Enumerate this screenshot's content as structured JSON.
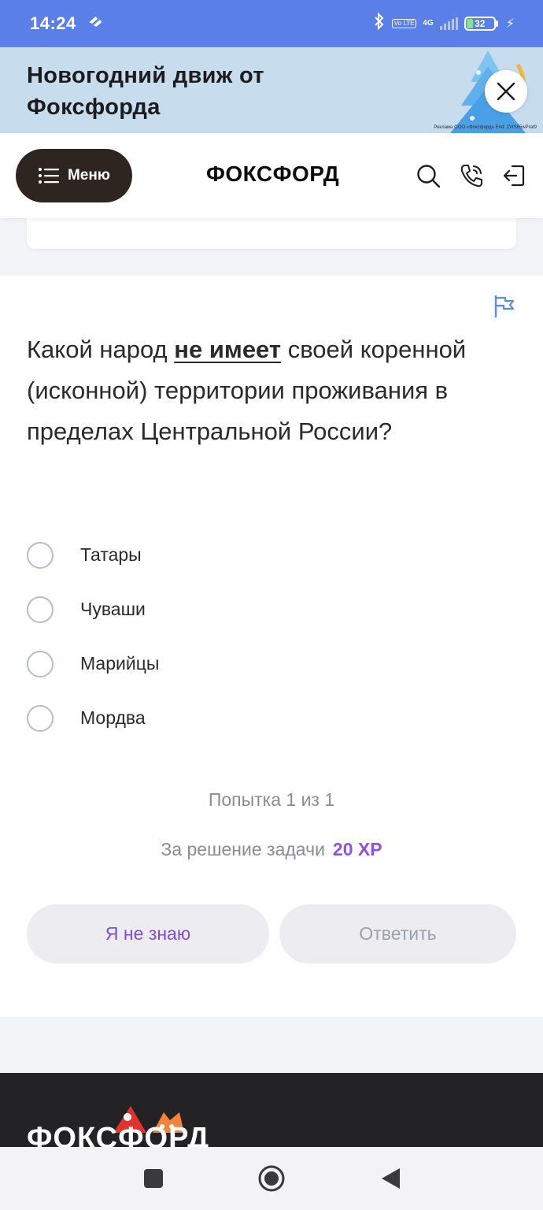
{
  "status_bar": {
    "time": "14:24",
    "network_volte": "Vo LTE",
    "network_type": "4G",
    "battery_level": "32"
  },
  "banner": {
    "title": "Новогодний движ от Фоксфорда",
    "title_line1": "Новогодний движ от",
    "title_line2": "Фоксфорда",
    "disclaimer": "Реклама ООО «Фоксфорд» Erid: 2VtS65wPrat9",
    "close_icon": "close-icon"
  },
  "header": {
    "menu_label": "Меню",
    "brand": "ФОКСФОРД",
    "icons": [
      "search-icon",
      "phone-icon",
      "login-icon"
    ]
  },
  "task": {
    "question_part1": "Какой народ ",
    "question_emph": "не имеет",
    "question_part2": " своей коренной (исконной) территории проживания в пределах Центральной России?",
    "options": [
      {
        "label": "Татары",
        "selected": false
      },
      {
        "label": "Чуваши",
        "selected": false
      },
      {
        "label": "Марийцы",
        "selected": false
      },
      {
        "label": "Мордва",
        "selected": false
      }
    ],
    "attempt_text": "Попытка 1 из 1",
    "reward_text": "За решение задачи",
    "reward_value": "20 XP",
    "skip_label": "Я не знаю",
    "answer_label": "Ответить"
  },
  "footer": {
    "logo": "ФОКСФОРД"
  },
  "colors": {
    "status_bar": "#5b7fe8",
    "banner_bg": "#c7dced",
    "menu_button": "#2e2520",
    "accent_purple": "#8a54e0",
    "footer_bg": "#232325"
  }
}
